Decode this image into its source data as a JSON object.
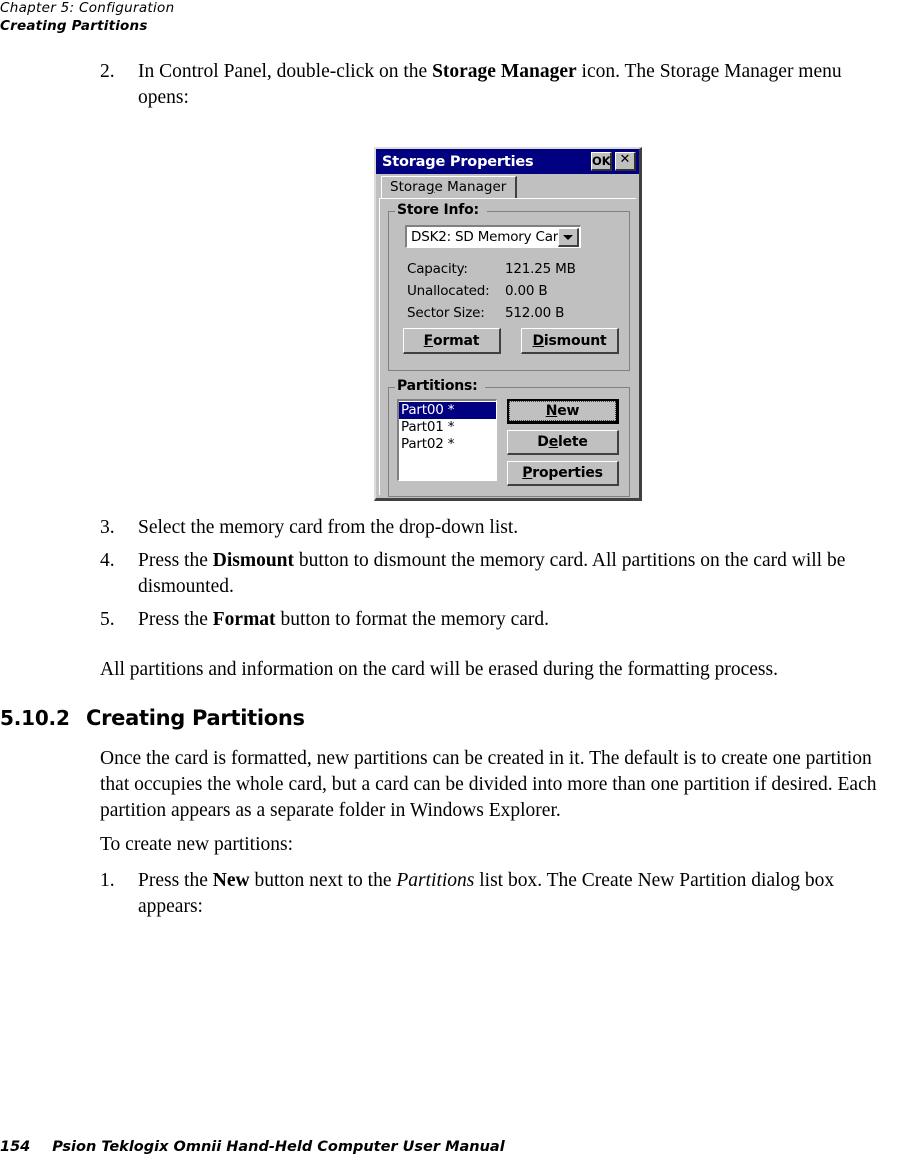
{
  "header": {
    "chapter": "Chapter 5:  Configuration",
    "section": "Creating Partitions"
  },
  "steps_top": [
    {
      "num": "2.",
      "parts": [
        {
          "t": "In Control Panel, double-click on the ",
          "s": "n"
        },
        {
          "t": "Storage Manager",
          "s": "b"
        },
        {
          "t": " icon. The Storage Manager menu opens:",
          "s": "n"
        }
      ]
    }
  ],
  "steps_mid": [
    {
      "num": "3.",
      "parts": [
        {
          "t": "Select the memory card from the drop-down list.",
          "s": "n"
        }
      ]
    },
    {
      "num": "4.",
      "parts": [
        {
          "t": "Press the ",
          "s": "n"
        },
        {
          "t": "Dismount",
          "s": "b"
        },
        {
          "t": " button to dismount the memory card. All partitions on the card will be dismounted.",
          "s": "n"
        }
      ]
    },
    {
      "num": "5.",
      "parts": [
        {
          "t": "Press the ",
          "s": "n"
        },
        {
          "t": "Format",
          "s": "b"
        },
        {
          "t": " button to format the memory card.",
          "s": "n"
        }
      ]
    }
  ],
  "paragraph_erase": "All partitions and information on the card will be erased during the formatting process.",
  "section_heading": {
    "number": "5.10.2",
    "title": "Creating Partitions"
  },
  "paragraph_intro": "Once the card is formatted, new partitions can be created in it. The default is to create one partition that occupies the whole card, but a card can be divided into more than one partition if desired. Each partition appears as a separate folder in Windows Explorer.",
  "paragraph_tocreate": "To create new partitions:",
  "steps_bottom": [
    {
      "num": "1.",
      "parts": [
        {
          "t": "Press the ",
          "s": "n"
        },
        {
          "t": "New",
          "s": "b"
        },
        {
          "t": " button next to the ",
          "s": "n"
        },
        {
          "t": "Partitions",
          "s": "i"
        },
        {
          "t": " list box. The Create New Partition dialog box appears:",
          "s": "n"
        }
      ]
    }
  ],
  "dialog": {
    "title": "Storage Properties",
    "titlebar_buttons": [
      {
        "name": "ok-button",
        "label": "OK"
      },
      {
        "name": "close-button",
        "label": "✕"
      }
    ],
    "tab": {
      "label_pre": "Stora",
      "label_underline": "g",
      "label_post": "e Manager",
      "full": "Storage Manager"
    },
    "store_info": {
      "group_label": "Store Info:",
      "combo_value": "DSK2: SD Memory Car",
      "rows": [
        {
          "label": "Capacity:",
          "value": "121.25 MB"
        },
        {
          "label": "Unallocated:",
          "value": "0.00 B"
        },
        {
          "label": "Sector Size:",
          "value": "512.00 B"
        }
      ],
      "buttons": [
        {
          "name": "format-button",
          "pre": "",
          "u": "F",
          "post": "ormat"
        },
        {
          "name": "dismount-button",
          "pre": "",
          "u": "D",
          "post": "ismount"
        }
      ]
    },
    "partitions": {
      "group_label": "Partitions:",
      "list": [
        {
          "label": "Part00 *",
          "selected": true
        },
        {
          "label": "Part01 *",
          "selected": false
        },
        {
          "label": "Part02 *",
          "selected": false
        }
      ],
      "buttons": [
        {
          "name": "new-button",
          "pre": "",
          "u": "N",
          "post": "ew",
          "focused": true
        },
        {
          "name": "delete-button",
          "pre": "D",
          "u": "e",
          "post": "lete",
          "focused": false
        },
        {
          "name": "properties-button",
          "pre": "",
          "u": "P",
          "post": "roperties",
          "focused": false
        }
      ]
    }
  },
  "footer": {
    "page": "154",
    "text": "Psion Teklogix Omnii Hand-Held Computer User Manual"
  },
  "colors": {
    "titlebar": "#000080",
    "dialog_face": "#c0c0c0",
    "selection": "#000080"
  }
}
